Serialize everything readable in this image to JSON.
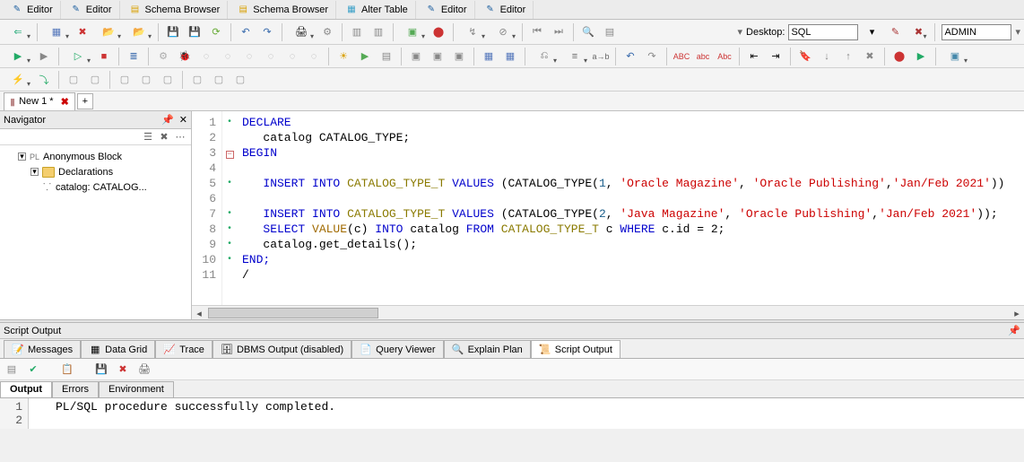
{
  "top_tabs": [
    {
      "label": "Editor",
      "kind": "editor"
    },
    {
      "label": "Editor",
      "kind": "editor"
    },
    {
      "label": "Schema Browser",
      "kind": "schema"
    },
    {
      "label": "Schema Browser",
      "kind": "schema"
    },
    {
      "label": "Alter Table",
      "kind": "table"
    },
    {
      "label": "Editor",
      "kind": "editor"
    },
    {
      "label": "Editor",
      "kind": "editor"
    }
  ],
  "desktop": {
    "label": "Desktop:",
    "value": "SQL"
  },
  "user": "ADMIN",
  "doc_tab": {
    "label": "New 1 *"
  },
  "navigator": {
    "title": "Navigator",
    "root": "Anonymous Block",
    "decl": "Declarations",
    "leaf": "catalog: CATALOG..."
  },
  "code_lines": [
    {
      "n": 1,
      "dot": true
    },
    {
      "n": 2
    },
    {
      "n": 3,
      "dot": true,
      "box": true
    },
    {
      "n": 4
    },
    {
      "n": 5,
      "dot": true
    },
    {
      "n": 6
    },
    {
      "n": 7,
      "dot": true
    },
    {
      "n": 8,
      "dot": true
    },
    {
      "n": 9,
      "dot": true
    },
    {
      "n": 10,
      "dot": true
    },
    {
      "n": 11
    }
  ],
  "code_tokens": {
    "l1": "DECLARE",
    "l2_a": "catalog CATALOG_TYPE;",
    "l3": "BEGIN",
    "l5_insert": "INSERT",
    "l5_into": "INTO",
    "l5_tbl": "CATALOG_TYPE_T",
    "l5_values": "VALUES",
    "l5_ct": "CATALOG_TYPE",
    "l5_n": "1",
    "l5_s1": "'Oracle Magazine'",
    "l5_s2": "'Oracle Publishing'",
    "l5_s3": "'Jan/Feb 2021'",
    "l7_insert": "INSERT",
    "l7_into": "INTO",
    "l7_tbl": "CATALOG_TYPE_T",
    "l7_values": "VALUES",
    "l7_ct": "CATALOG_TYPE",
    "l7_n": "2",
    "l7_s1": "'Java Magazine'",
    "l7_s2": "'Oracle Publishing'",
    "l7_s3": "'Jan/Feb 2021'",
    "l8_select": "SELECT",
    "l8_value": "VALUE",
    "l8_into": "INTO",
    "l8_from": "FROM",
    "l8_tbl": "CATALOG_TYPE_T",
    "l8_where": "WHERE",
    "l8_cond": "c.id = 2;",
    "l8_catalog": "catalog",
    "l8_c": "c",
    "l9": "catalog.get_details();",
    "l10": "END;",
    "l11": "/"
  },
  "script_output": {
    "title": "Script Output"
  },
  "bottom_tabs": [
    "Messages",
    "Data Grid",
    "Trace",
    "DBMS Output (disabled)",
    "Query Viewer",
    "Explain Plan",
    "Script Output"
  ],
  "bottom_tabs_active": 6,
  "sub_tabs": [
    "Output",
    "Errors",
    "Environment"
  ],
  "sub_tabs_active": 0,
  "output_lines": [
    {
      "n": 1,
      "text": "PL/SQL procedure successfully completed."
    },
    {
      "n": 2,
      "text": ""
    }
  ]
}
